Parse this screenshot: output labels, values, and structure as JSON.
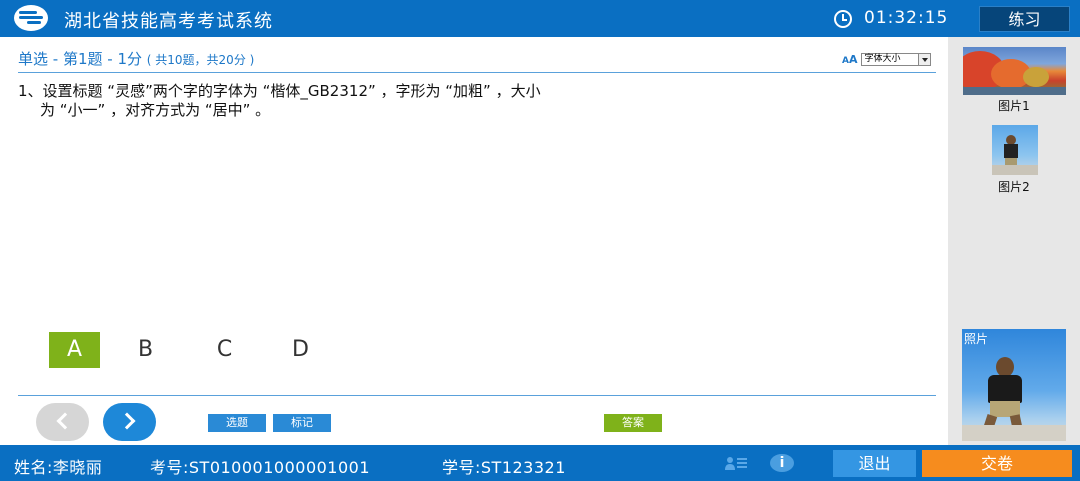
{
  "app": {
    "title": "湖北省技能高考考试系统"
  },
  "header": {
    "timer": "01:32:15",
    "mode_label": "练习"
  },
  "question": {
    "type_label": "单选 - 第1题 - 1分",
    "summary": "( 共10题，共20分 )",
    "font_size_label": "字体大小",
    "text_line1": "1、设置标题 “灵感”两个字的字体为 “楷体_GB2312” ，字形为 “加粗” ，大小",
    "text_line2": "为 “小一” ，对齐方式为 “居中” 。"
  },
  "options": [
    {
      "label": "A",
      "selected": true
    },
    {
      "label": "B",
      "selected": false
    },
    {
      "label": "C",
      "selected": false
    },
    {
      "label": "D",
      "selected": false
    }
  ],
  "buttons": {
    "select_question": "选题",
    "mark": "标记",
    "answer": "答案"
  },
  "sidebar": {
    "images": [
      {
        "label": "图片1"
      },
      {
        "label": "图片2"
      }
    ],
    "photo_label": "照片"
  },
  "footer": {
    "name": "姓名:李晓丽",
    "exam_no": "考号:ST010001000001001",
    "student_no": "学号:ST123321",
    "exit_label": "退出",
    "submit_label": "交卷"
  },
  "colors": {
    "primary": "#0a6fc2",
    "selected_option": "#7fb21a",
    "submit": "#f68c1e",
    "exit": "#3496e3"
  }
}
